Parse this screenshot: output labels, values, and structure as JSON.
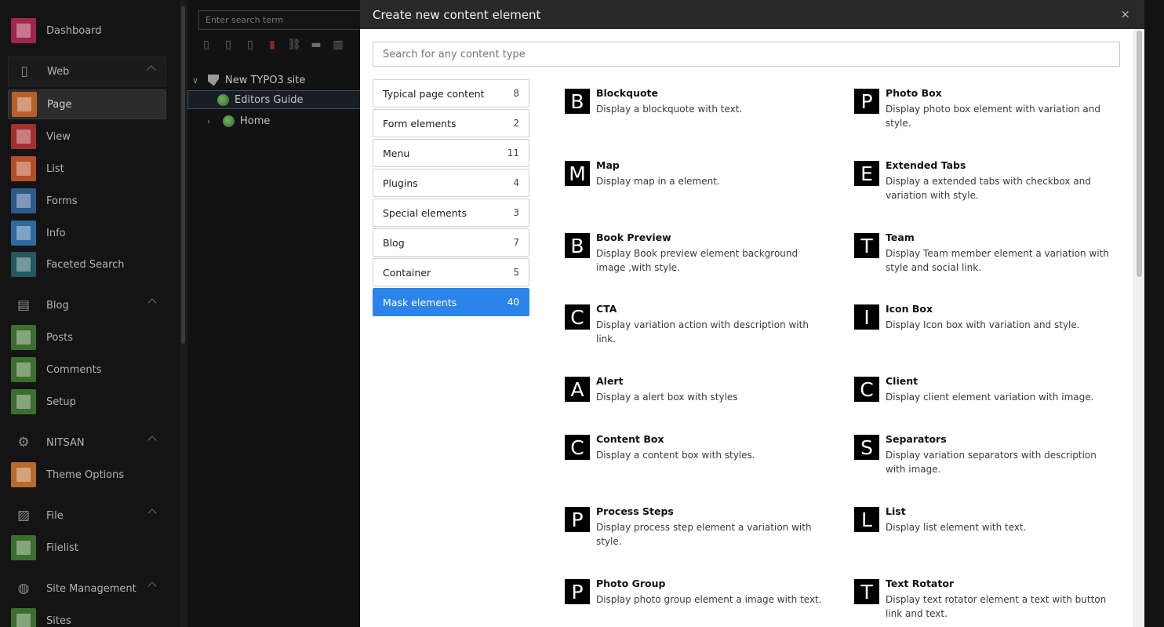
{
  "sidebar": {
    "items": [
      {
        "label": "Dashboard",
        "icon": "dashboard-icon",
        "color": "#a0264b",
        "type": "item"
      },
      {
        "label": "Web",
        "icon": "file-icon",
        "type": "group"
      },
      {
        "label": "Page",
        "icon": "page-icon",
        "color": "#b8602b",
        "type": "item",
        "active": true
      },
      {
        "label": "View",
        "icon": "eye-icon",
        "color": "#a42f2f",
        "type": "item"
      },
      {
        "label": "List",
        "icon": "list-icon",
        "color": "#b34e28",
        "type": "item"
      },
      {
        "label": "Forms",
        "icon": "forms-icon",
        "color": "#2c5a8a",
        "type": "item"
      },
      {
        "label": "Info",
        "icon": "info-icon",
        "color": "#2d6aa1",
        "type": "item"
      },
      {
        "label": "Faceted Search",
        "icon": "binoculars-icon",
        "color": "#23585f",
        "type": "item"
      },
      {
        "label": "Blog",
        "icon": "newspaper-icon",
        "type": "group"
      },
      {
        "label": "Posts",
        "icon": "posts-icon",
        "color": "#3c6e2e",
        "type": "item"
      },
      {
        "label": "Comments",
        "icon": "comments-icon",
        "color": "#3c6e2e",
        "type": "item"
      },
      {
        "label": "Setup",
        "icon": "gear-icon",
        "color": "#3c6e2e",
        "type": "item"
      },
      {
        "label": "NITSAN",
        "icon": "gear-icon",
        "type": "group"
      },
      {
        "label": "Theme Options",
        "icon": "box-icon",
        "color": "#b86b2b",
        "type": "item"
      },
      {
        "label": "File",
        "icon": "image-icon",
        "type": "group"
      },
      {
        "label": "Filelist",
        "icon": "filelist-icon",
        "color": "#3c6e2e",
        "type": "item"
      },
      {
        "label": "Site Management",
        "icon": "globe-icon",
        "type": "group"
      },
      {
        "label": "Sites",
        "icon": "sites-icon",
        "color": "#3c6e2e",
        "type": "item"
      }
    ]
  },
  "tree": {
    "search_placeholder": "Enter search term",
    "nodes": [
      {
        "label": "New TYPO3 site"
      },
      {
        "label": "Editors Guide"
      },
      {
        "label": "Home"
      }
    ]
  },
  "modal": {
    "title": "Create new content element",
    "close": "×",
    "search_placeholder": "Search for any content type",
    "tabs": [
      {
        "label": "Typical page content",
        "count": "8"
      },
      {
        "label": "Form elements",
        "count": "2"
      },
      {
        "label": "Menu",
        "count": "11"
      },
      {
        "label": "Plugins",
        "count": "4"
      },
      {
        "label": "Special elements",
        "count": "3"
      },
      {
        "label": "Blog",
        "count": "7"
      },
      {
        "label": "Container",
        "count": "5"
      },
      {
        "label": "Mask elements",
        "count": "40",
        "active": true
      }
    ],
    "elements": [
      {
        "letter": "B",
        "name": "Blockquote",
        "desc": "Display a blockquote with text."
      },
      {
        "letter": "P",
        "name": "Photo Box",
        "desc": "Display photo box element with variation and style."
      },
      {
        "letter": "M",
        "name": "Map",
        "desc": "Display map in a element."
      },
      {
        "letter": "E",
        "name": "Extended Tabs",
        "desc": "Display a extended tabs with checkbox and variation with style."
      },
      {
        "letter": "B",
        "name": "Book Preview",
        "desc": "Display Book preview element background image ,with style."
      },
      {
        "letter": "T",
        "name": "Team",
        "desc": "Display Team member element a variation with style and social link."
      },
      {
        "letter": "C",
        "name": "CTA",
        "desc": "Display variation action with description with link."
      },
      {
        "letter": "I",
        "name": "Icon Box",
        "desc": "Display Icon box with variation and style."
      },
      {
        "letter": "A",
        "name": "Alert",
        "desc": "Display a alert box with styles"
      },
      {
        "letter": "C",
        "name": "Client",
        "desc": "Display client element variation with image."
      },
      {
        "letter": "C",
        "name": "Content Box",
        "desc": "Display a content box with styles."
      },
      {
        "letter": "S",
        "name": "Separators",
        "desc": "Display variation separators with description with image."
      },
      {
        "letter": "P",
        "name": "Process Steps",
        "desc": "Display process step element a variation with style."
      },
      {
        "letter": "L",
        "name": "List",
        "desc": "Display list element with text."
      },
      {
        "letter": "P",
        "name": "Photo Group",
        "desc": "Display photo group element a image with text."
      },
      {
        "letter": "T",
        "name": "Text Rotator",
        "desc": "Display text rotator element a text with button link and text."
      }
    ]
  },
  "colors": {
    "accent": "#2b84e9",
    "modal_header": "#292929"
  }
}
